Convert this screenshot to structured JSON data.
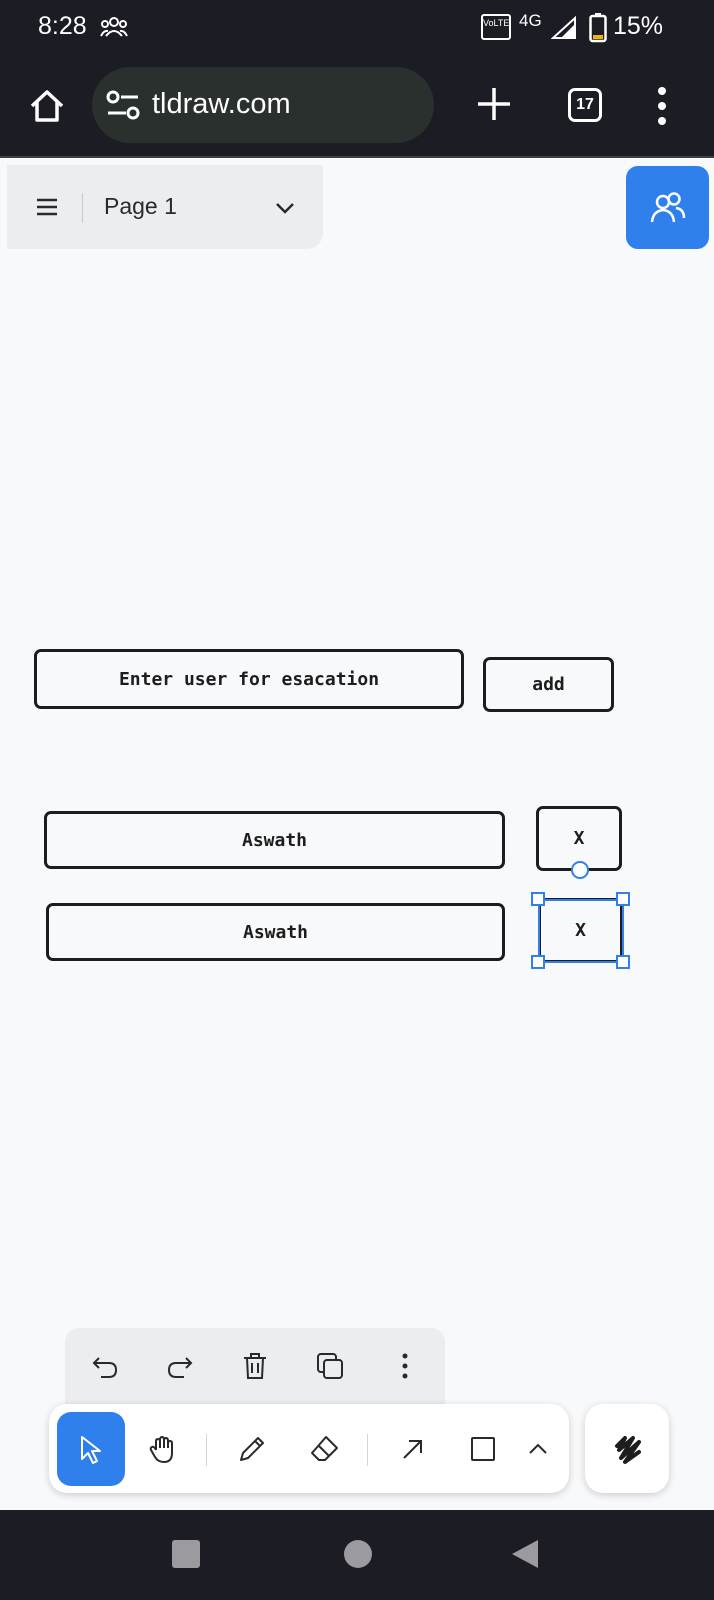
{
  "status_bar": {
    "time": "8:28",
    "volte": "VoLTE",
    "network": "4G",
    "battery": "15%"
  },
  "browser": {
    "url": "tldraw.com",
    "tab_count": "17"
  },
  "page_menu": {
    "page_name": "Page 1"
  },
  "canvas": {
    "input_box_text": "Enter user for esacation",
    "add_button_text": "add",
    "rows": [
      {
        "name": "Aswath",
        "remove": "X"
      },
      {
        "name": "Aswath",
        "remove": "X"
      }
    ]
  },
  "colors": {
    "accent": "#2f80ed",
    "chrome_bg": "#1b1c24",
    "canvas_bg": "#f8f9fb"
  },
  "icons": {
    "status": [
      "people-icon",
      "volte-icon",
      "signal-icon",
      "battery-icon"
    ],
    "browser": [
      "home-icon",
      "site-settings-icon",
      "new-tab-icon",
      "tab-switcher-icon",
      "overflow-menu-icon"
    ],
    "actions": [
      "undo-icon",
      "redo-icon",
      "trash-icon",
      "duplicate-icon",
      "more-icon"
    ],
    "tools": [
      "select-icon",
      "hand-icon",
      "pencil-icon",
      "eraser-icon",
      "arrow-icon",
      "rectangle-icon",
      "chevron-up-icon",
      "style-scribble-icon"
    ]
  }
}
